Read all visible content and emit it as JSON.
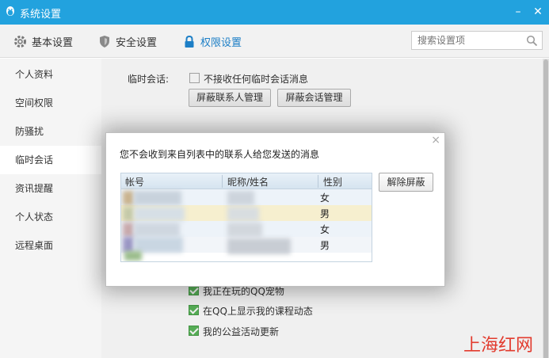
{
  "window": {
    "title": "系统设置",
    "min": "–",
    "close": "✕"
  },
  "tabs": [
    {
      "label": "基本设置",
      "icon": "gear-icon"
    },
    {
      "label": "安全设置",
      "icon": "shield-icon"
    },
    {
      "label": "权限设置",
      "icon": "lock-icon"
    }
  ],
  "search": {
    "placeholder": "搜索设置项"
  },
  "sidebar": {
    "items": [
      {
        "label": "个人资料"
      },
      {
        "label": "空间权限"
      },
      {
        "label": "防骚扰"
      },
      {
        "label": "临时会话"
      },
      {
        "label": "资讯提醒"
      },
      {
        "label": "个人状态"
      },
      {
        "label": "远程桌面"
      }
    ]
  },
  "temp_session": {
    "label": "临时会话:",
    "option": "不接收任何临时会话消息",
    "btn_contacts": "屏蔽联系人管理",
    "btn_sessions": "屏蔽会话管理"
  },
  "status_options": [
    "我正在玩的QQ宠物",
    "在QQ上显示我的课程动态",
    "我的公益活动更新"
  ],
  "dialog": {
    "message": "您不会收到来自列表中的联系人给您发送的消息",
    "close": "×",
    "columns": [
      "帐号",
      "昵称/姓名",
      "性别"
    ],
    "rows": [
      {
        "gender": "女"
      },
      {
        "gender": "男"
      },
      {
        "gender": "女"
      },
      {
        "gender": "男"
      }
    ],
    "unblock_button": "解除屏蔽"
  },
  "watermark": "上海红网",
  "colors": {
    "titlebar": "#22a2de",
    "active_tab": "#1d7fc6",
    "check_green": "#5bb75b",
    "watermark": "#e23b2e"
  }
}
